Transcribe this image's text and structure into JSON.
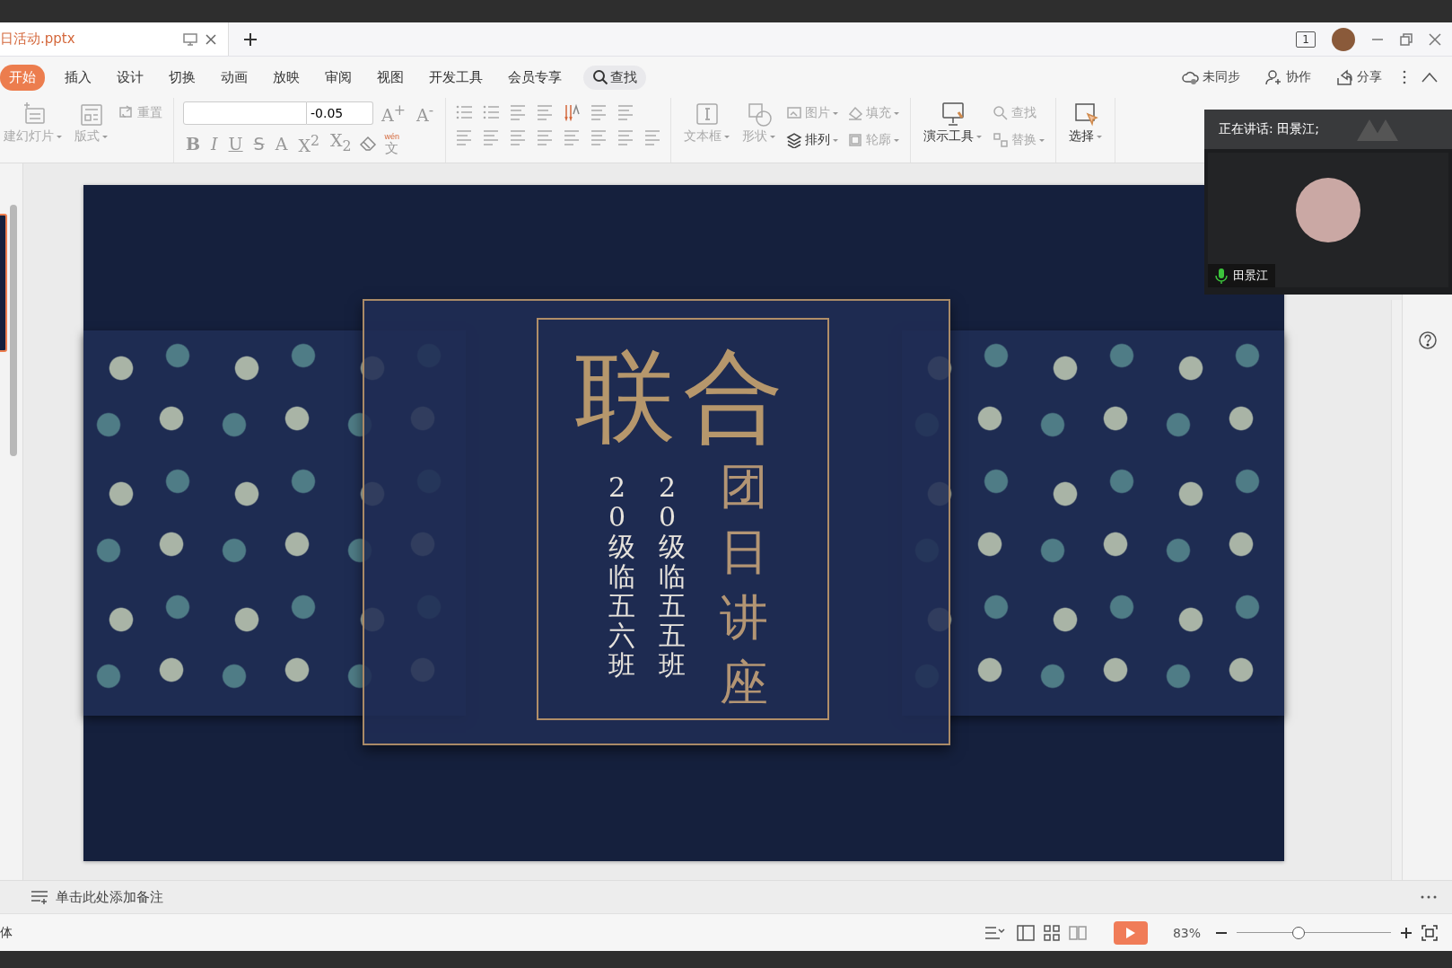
{
  "tab_bar": {
    "tabs": [
      {
        "title": "日活动.pptx",
        "selected": true
      }
    ],
    "window_count": "1"
  },
  "menu": {
    "items": [
      {
        "label": "开始",
        "selected": true
      },
      {
        "label": "插入",
        "selected": false
      },
      {
        "label": "设计",
        "selected": false
      },
      {
        "label": "切换",
        "selected": false
      },
      {
        "label": "动画",
        "selected": false
      },
      {
        "label": "放映",
        "selected": false
      },
      {
        "label": "审阅",
        "selected": false
      },
      {
        "label": "视图",
        "selected": false
      },
      {
        "label": "开发工具",
        "selected": false
      },
      {
        "label": "会员专享",
        "selected": false
      }
    ],
    "search": "查找",
    "actions": [
      {
        "label": "未同步"
      },
      {
        "label": "协作"
      },
      {
        "label": "分享"
      }
    ]
  },
  "ribbon": {
    "groups": [
      {
        "items": [
          {
            "kind": "large",
            "label": "建幻灯片",
            "dropdown": true,
            "disabled": true
          },
          {
            "kind": "large",
            "label": "版式",
            "dropdown": true,
            "disabled": true
          },
          {
            "kind": "small",
            "label": "重置",
            "dropdown": false,
            "disabled": true
          }
        ]
      },
      {
        "size_field": {
          "value": "-0.05"
        },
        "grow": "A$^{+}$",
        "shrink": "A$^{-}$",
        "glyphs": [
          "B",
          "I",
          "U",
          "S",
          "A",
          "X$^{2}$",
          "X$_{2}$"
        ],
        "phonetic": {
          "top": "wén",
          "main": "文"
        }
      },
      {
        "items": [
          {
            "kind": "large",
            "label": "文本框",
            "dropdown": true,
            "disabled": true
          },
          {
            "kind": "large",
            "label": "形状",
            "dropdown": true,
            "disabled": true
          },
          {
            "kind": "small",
            "label": "图片",
            "dropdown": true,
            "disabled": true
          },
          {
            "kind": "small",
            "label": "排列",
            "dropdown": true,
            "disabled": false
          },
          {
            "kind": "small",
            "label": "填充",
            "dropdown": true,
            "disabled": true
          },
          {
            "kind": "small",
            "label": "轮廓",
            "dropdown": true,
            "disabled": true
          }
        ]
      },
      {
        "items": [
          {
            "kind": "large",
            "label": "演示工具",
            "dropdown": true,
            "disabled": false
          },
          {
            "kind": "small",
            "label": "查找",
            "dropdown": false,
            "disabled": true
          },
          {
            "kind": "small",
            "label": "替换",
            "dropdown": true,
            "disabled": true
          }
        ]
      },
      {
        "items": [
          {
            "kind": "large",
            "label": "选择",
            "dropdown": true,
            "disabled": false
          }
        ]
      }
    ]
  },
  "slide": {
    "title": "联合",
    "subtitle": "团日讲座",
    "classes": [
      "20级临五六班",
      "20级临五五班"
    ]
  },
  "meeting": {
    "speaking": "正在讲话: 田景江;",
    "participant": {
      "name": "田景江",
      "muted": false
    }
  },
  "notes": {
    "placeholder": "单击此处添加备注"
  },
  "status_bar": {
    "left": "体",
    "zoom": "83%",
    "zoom_slider": {
      "level": 0.4
    }
  }
}
